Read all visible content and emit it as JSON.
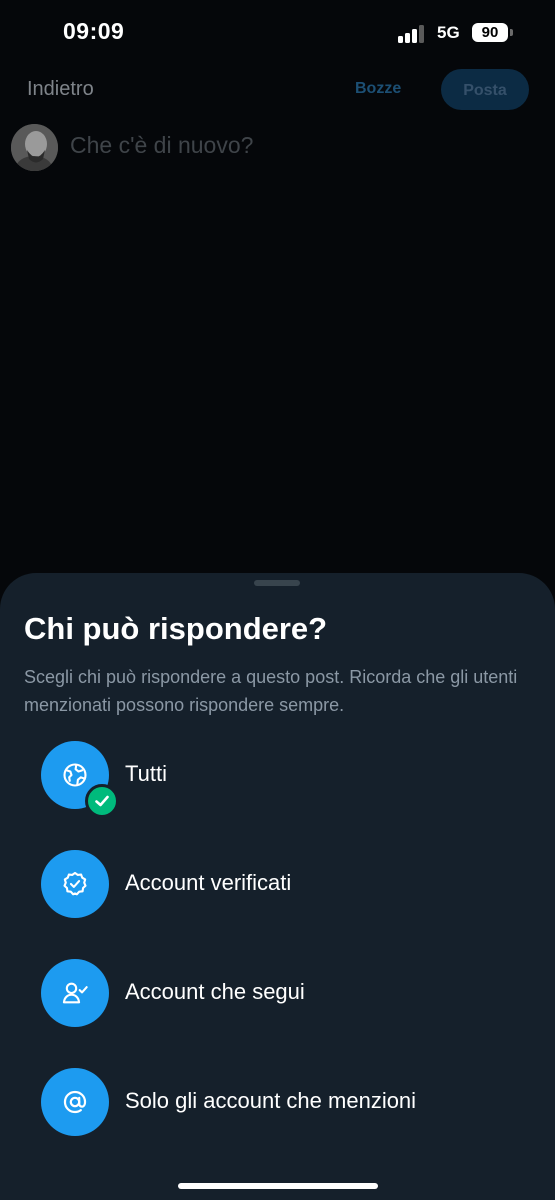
{
  "status_bar": {
    "time": "09:09",
    "network": "5G",
    "battery": "90"
  },
  "composer": {
    "back_label": "Indietro",
    "drafts_label": "Bozze",
    "post_label": "Posta",
    "input_placeholder": "Che c'è di nuovo?"
  },
  "reply_sheet": {
    "title": "Chi può rispondere?",
    "subtitle": "Scegli chi può rispondere a questo post. Ricorda che gli utenti menzionati possono rispondere sempre.",
    "options": [
      {
        "label": "Tutti",
        "icon": "globe-icon",
        "selected": true
      },
      {
        "label": "Account verificati",
        "icon": "verified-badge-icon",
        "selected": false
      },
      {
        "label": "Account che segui",
        "icon": "person-check-icon",
        "selected": false
      },
      {
        "label": "Solo gli account che menzioni",
        "icon": "at-sign-icon",
        "selected": false
      }
    ]
  },
  "colors": {
    "accent": "#1d9bf0",
    "selected_check": "#00ba7c",
    "sheet_background": "#15202b"
  }
}
